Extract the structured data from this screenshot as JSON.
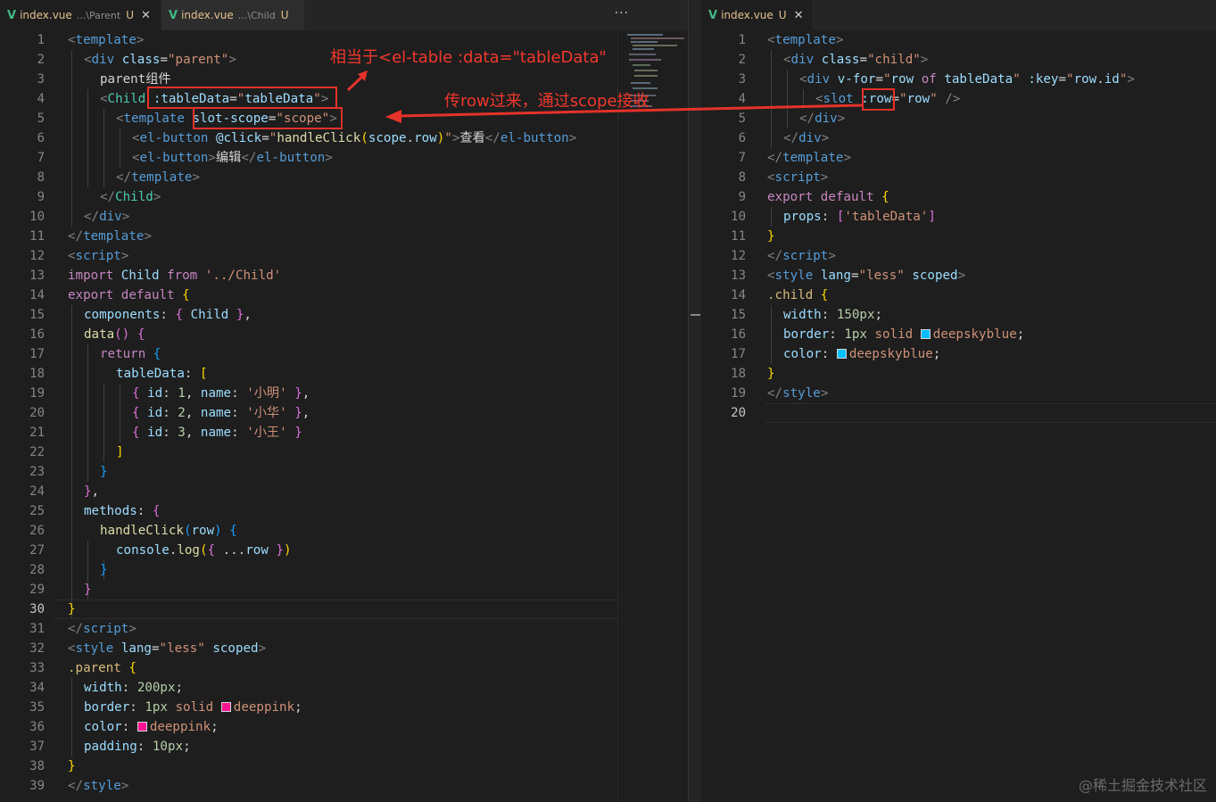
{
  "left_editor": {
    "tabs": [
      {
        "filename": "index.vue",
        "path": "...\\Parent",
        "status": "U",
        "close": "✕",
        "active": true
      },
      {
        "filename": "index.vue",
        "path": "...\\Child",
        "status": "U",
        "active": false
      }
    ],
    "more_label": "···",
    "current_line": 30
  },
  "right_editor": {
    "tab": {
      "filename": "index.vue",
      "status": "U",
      "close": "✕",
      "active": true
    },
    "current_line": 20
  },
  "annotations": {
    "top": "相当于<el-table :data=\"tableData\"",
    "middle": "传row过来，通过scope接收"
  },
  "watermark": "@稀土掘金技术社区",
  "colors": {
    "annotation_red": "#e5322b",
    "deeppink": "#ff1493",
    "deepskyblue": "#00bfff",
    "vue_green": "#42b883"
  }
}
